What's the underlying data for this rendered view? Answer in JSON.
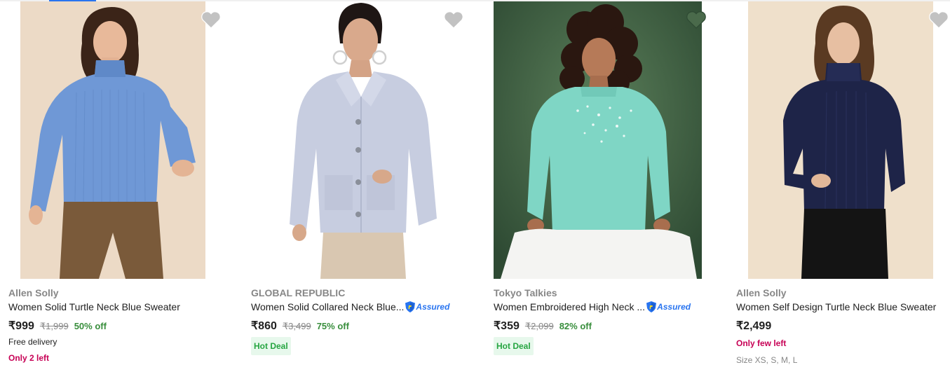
{
  "icons": {
    "wishlist": "heart-icon",
    "assured": "assured-shield-icon"
  },
  "colors": {
    "accent": "#2874f0",
    "discount": "#388e3c",
    "stock_alert": "#c70055",
    "hot_deal_bg": "#e7f8ec",
    "hot_deal_text": "#26a541",
    "muted": "#878787"
  },
  "products": [
    {
      "brand": "Allen Solly",
      "title": "Women Solid Turtle Neck Blue Sweater",
      "price": "₹999",
      "mrp": "₹1,999",
      "discount": "50% off",
      "delivery": "Free delivery",
      "stock": "Only 2 left"
    },
    {
      "brand": "GLOBAL REPUBLIC",
      "title": "Women Solid Collared Neck Blue...",
      "assured": "Assured",
      "price": "₹860",
      "mrp": "₹3,499",
      "discount": "75% off",
      "badge": "Hot Deal"
    },
    {
      "brand": "Tokyo Talkies",
      "title": "Women Embroidered High Neck ...",
      "assured": "Assured",
      "price": "₹359",
      "mrp": "₹2,099",
      "discount": "82% off",
      "badge": "Hot Deal"
    },
    {
      "brand": "Allen Solly",
      "title": "Women Self Design Turtle Neck Blue Sweater",
      "price": "₹2,499",
      "stock": "Only few left",
      "sizes": "Size XS, S, M, L"
    }
  ]
}
